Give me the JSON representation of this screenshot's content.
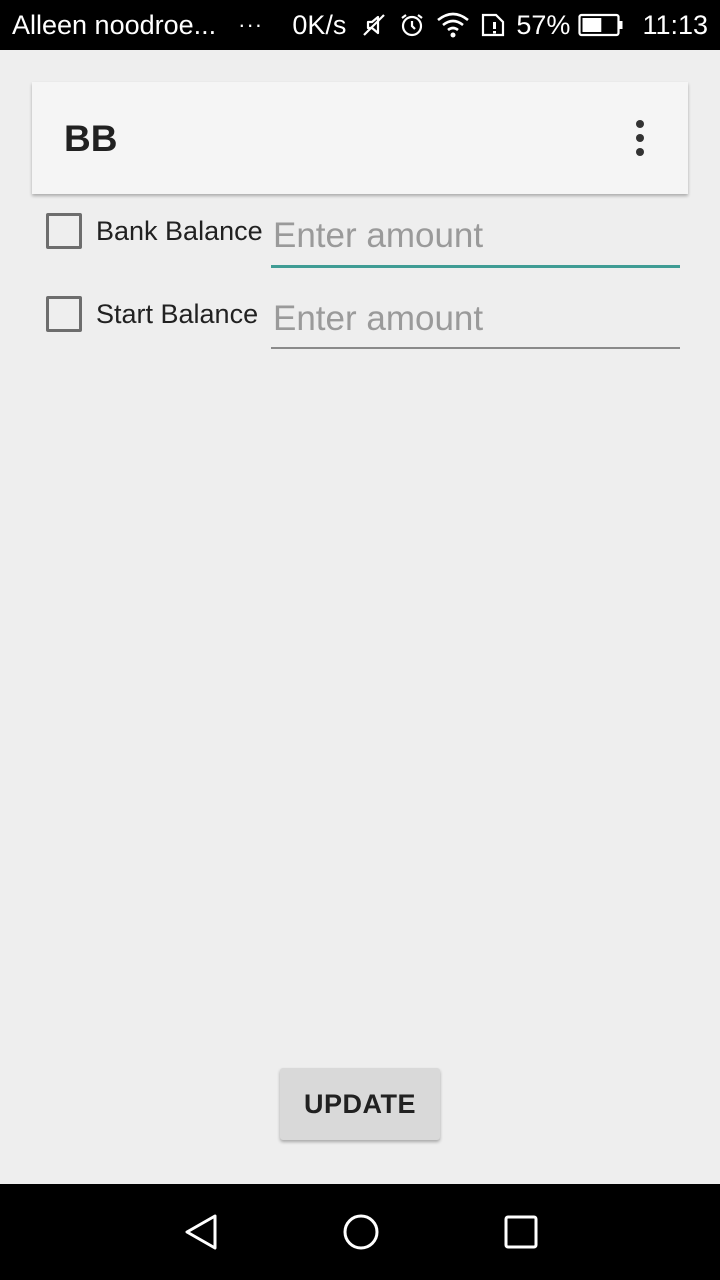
{
  "status_bar": {
    "carrier": "Alleen noodroe...",
    "dots": "···",
    "speed": "0K/s",
    "battery_percent": "57%",
    "battery_level": 0.57,
    "time": "11:13",
    "icons": [
      "mute-icon",
      "alarm-icon",
      "wifi-icon",
      "sim-icon",
      "battery-icon"
    ]
  },
  "app_bar": {
    "title": "BB",
    "overflow_icon": "more-vertical-icon"
  },
  "rows": [
    {
      "label": "Bank Balance",
      "value": "",
      "placeholder": "Enter amount",
      "checked": false,
      "focused": true
    },
    {
      "label": "Start Balance",
      "value": "",
      "placeholder": "Enter amount",
      "checked": false,
      "focused": false
    }
  ],
  "update_button": {
    "label": "UPDATE"
  },
  "nav_bar": {
    "icons": [
      "back-icon",
      "home-icon",
      "recents-icon"
    ]
  },
  "colors": {
    "accent": "#3f9c94",
    "background": "#eeeeee",
    "app_bar": "#f5f5f5",
    "button": "#d9d9d9"
  }
}
